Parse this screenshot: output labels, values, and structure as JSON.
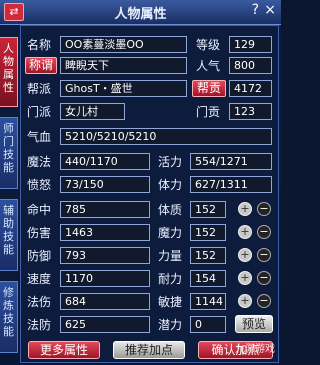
{
  "window": {
    "title": "人物属性",
    "system_button": "⇄",
    "help_label": "?",
    "close_label": "×"
  },
  "sidetabs": [
    "人物属性",
    "师门技能",
    "辅助技能",
    "修炼技能"
  ],
  "basic": {
    "name_label": "名称",
    "name_value": "OO素蔓淡墨OO",
    "level_label": "等级",
    "level_value": "129",
    "title_button": "称谓",
    "title_value": "睥睨天下",
    "popularity_label": "人气",
    "popularity_value": "800",
    "faction_label": "帮派",
    "faction_value": "GhosT・盛世",
    "contribution_button": "帮贡",
    "contribution_value": "4172",
    "sect_label": "门派",
    "sect_value": "女儿村",
    "sect_contrib_label": "门贡",
    "sect_contrib_value": "123",
    "hp_label": "气血",
    "hp_value": "5210/5210/5210"
  },
  "stats": {
    "mp_label": "魔法",
    "mp_value": "440/1170",
    "vitality_label": "活力",
    "vitality_value": "554/1271",
    "anger_label": "愤怒",
    "anger_value": "73/150",
    "stamina_label": "体力",
    "stamina_value": "627/1311",
    "hit_label": "命中",
    "hit_value": "785",
    "physique_label": "体质",
    "physique_value": "152",
    "damage_label": "伤害",
    "damage_value": "1463",
    "magic_label": "魔力",
    "magic_value": "152",
    "defense_label": "防御",
    "defense_value": "793",
    "strength_label": "力量",
    "strength_value": "152",
    "speed_label": "速度",
    "speed_value": "1170",
    "endurance_label": "耐力",
    "endurance_value": "154",
    "spell_dmg_label": "法伤",
    "spell_dmg_value": "684",
    "agility_label": "敏捷",
    "agility_value": "1144",
    "spell_def_label": "法防",
    "spell_def_value": "625",
    "potential_label": "潜力",
    "potential_value": "0",
    "preview_button": "预览"
  },
  "bottom": {
    "more_button": "更多属性",
    "recommend_button": "推荐加点",
    "confirm_button": "确认加点"
  },
  "watermark": "九游游戏"
}
